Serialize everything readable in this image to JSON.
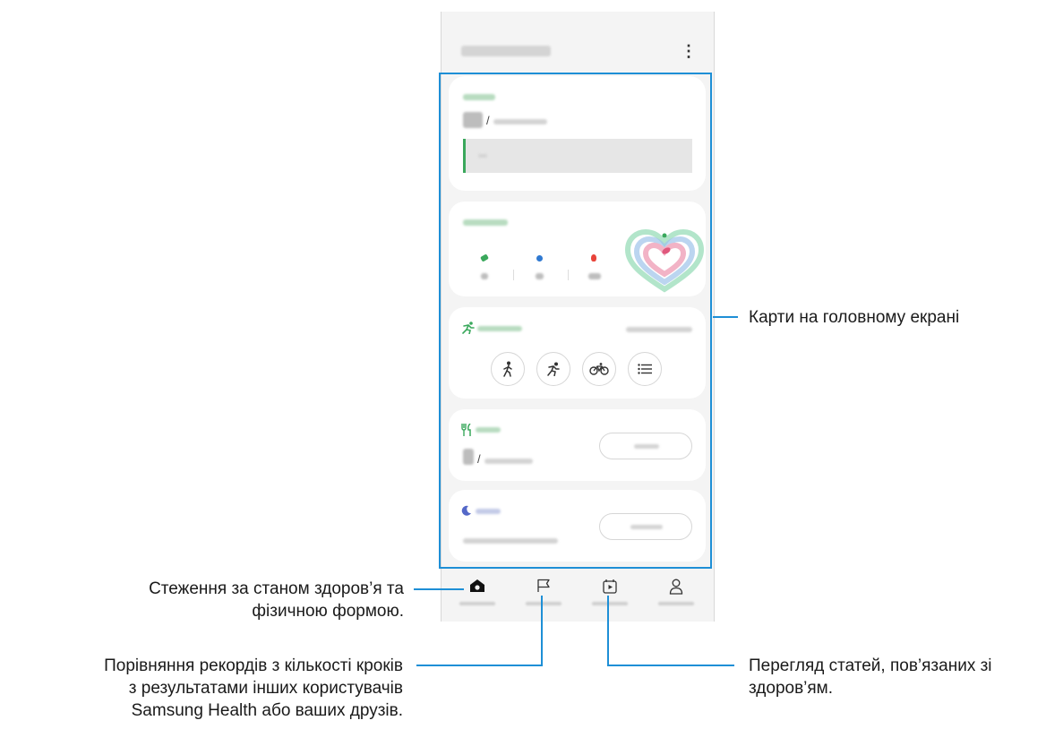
{
  "annotations": {
    "cards": "Карти на головному екрані",
    "home_line1": "Стеження за станом здоров’я та",
    "home_line2": "фізичною формою.",
    "together_line1": "Порівняння рекордів з кількості кроків",
    "together_line2": "з результатами інших користувачів",
    "together_line3": "Samsung Health або ваших друзів.",
    "fitness_line1": "Перегляд статей, пов’язаних зі",
    "fitness_line2": "здоров’ям."
  },
  "colors": {
    "callout_line": "#1e8fd6",
    "steps_accent": "#3aa85c",
    "heart_ring_green": "#7fd3a6",
    "heart_ring_blue": "#9ec3ea",
    "heart_ring_pink": "#f2b3c6"
  },
  "icons": {
    "more": "more-vertical-icon",
    "run_header": "running-icon",
    "walk": "walking-icon",
    "run": "running-icon",
    "cycle": "cycling-icon",
    "list": "list-icon",
    "food": "fork-knife-icon",
    "sleep": "moon-icon",
    "nav_home": "home-icon",
    "nav_together": "flag-icon",
    "nav_fitness": "play-calendar-icon",
    "nav_profile": "person-icon"
  },
  "screen": {
    "more_glyph": "⋮"
  }
}
